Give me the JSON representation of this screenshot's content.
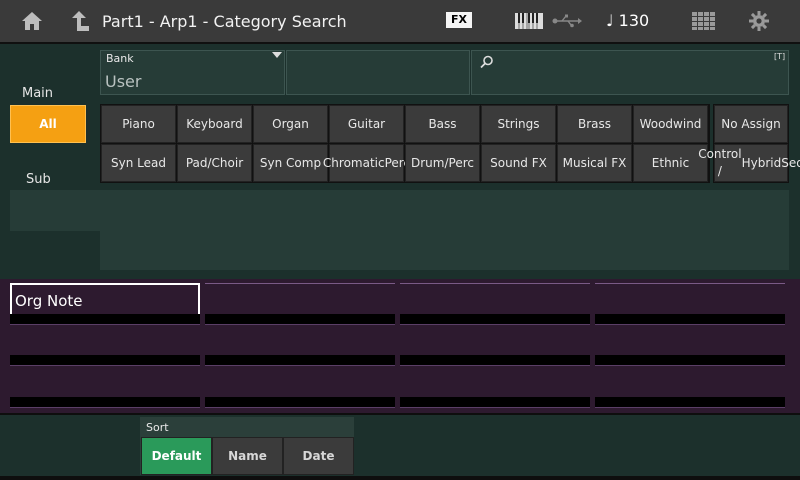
{
  "header": {
    "title": "Part1 - Arp1 - Category Search",
    "fx_badge": "FX",
    "tempo": "♩ 130",
    "icons": [
      "home-icon",
      "up-arrow-icon",
      "keyboard-icon",
      "usb-icon",
      "grid-icon",
      "gear-icon"
    ]
  },
  "bank": {
    "label": "Bank",
    "value": "User"
  },
  "search": {
    "t_label": "[T]"
  },
  "main": {
    "label": "Main",
    "all_label": "All"
  },
  "sub": {
    "label": "Sub"
  },
  "categories": {
    "row1": [
      "Piano",
      "Keyboard",
      "Organ",
      "Guitar",
      "Bass",
      "Strings",
      "Brass",
      "Woodwind"
    ],
    "row2": [
      "Syn Lead",
      "Pad/Choir",
      "Syn Comp",
      "Chromatic\nPerc",
      "Drum/Perc",
      "Sound FX",
      "Musical FX",
      "Ethnic"
    ],
    "right": [
      "No Assign",
      "Control /\nHybridSeq"
    ]
  },
  "results": {
    "selected": "Org Note"
  },
  "sort": {
    "label": "Sort",
    "options": [
      "Default",
      "Name",
      "Date"
    ],
    "selected": "Default"
  },
  "colors": {
    "accent": "#f5a012",
    "selected_sort": "#2a9a5a",
    "background": "#1c302c",
    "results_bg": "#2d1a2f"
  }
}
